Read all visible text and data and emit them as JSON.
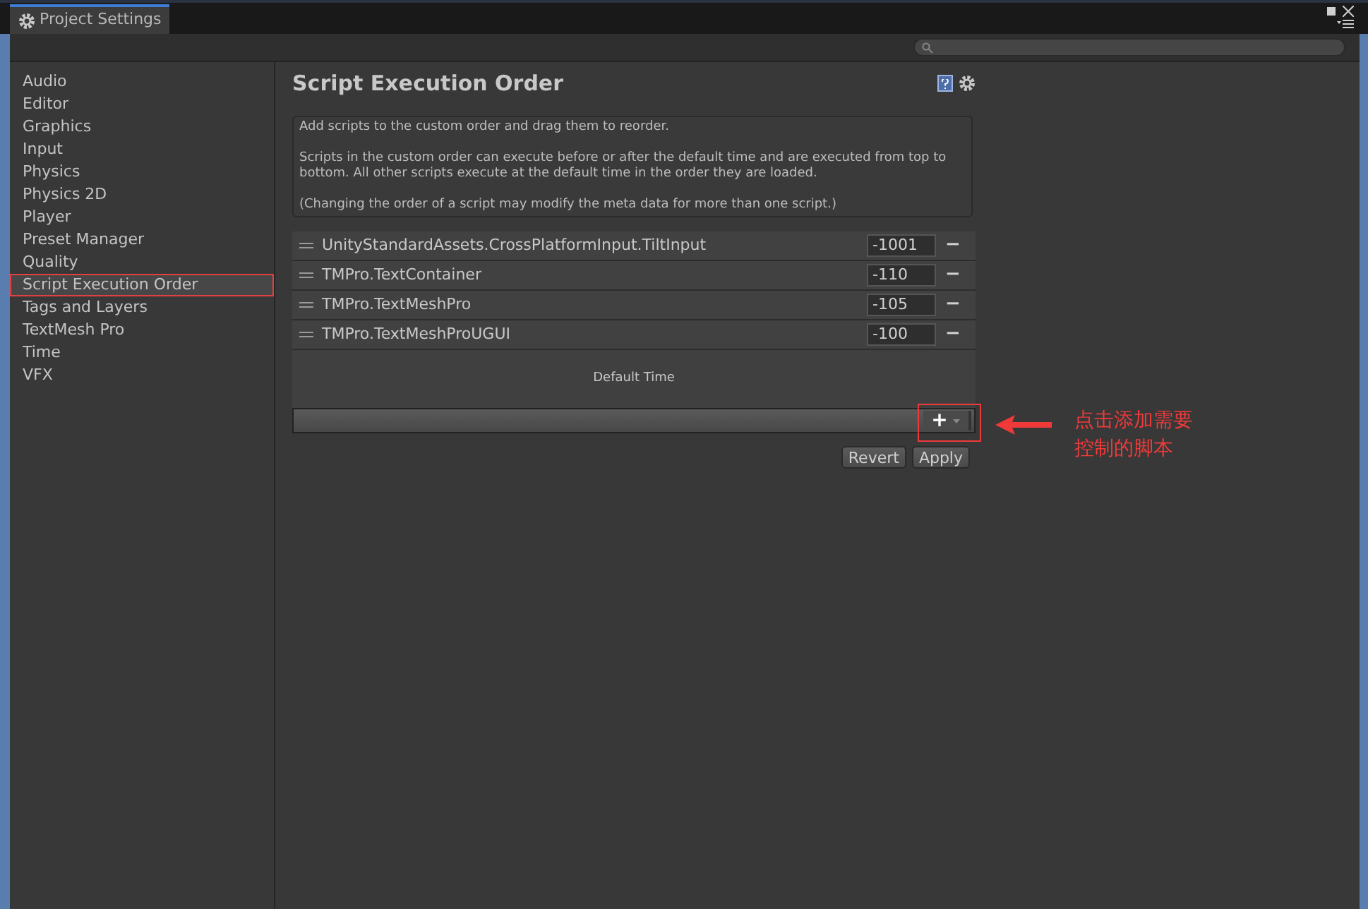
{
  "window": {
    "tab_title": "Project Settings"
  },
  "sidebar": {
    "items": [
      {
        "label": "Audio",
        "selected": false
      },
      {
        "label": "Editor",
        "selected": false
      },
      {
        "label": "Graphics",
        "selected": false
      },
      {
        "label": "Input",
        "selected": false
      },
      {
        "label": "Physics",
        "selected": false
      },
      {
        "label": "Physics 2D",
        "selected": false
      },
      {
        "label": "Player",
        "selected": false
      },
      {
        "label": "Preset Manager",
        "selected": false
      },
      {
        "label": "Quality",
        "selected": false
      },
      {
        "label": "Script Execution Order",
        "selected": true
      },
      {
        "label": "Tags and Layers",
        "selected": false
      },
      {
        "label": "TextMesh Pro",
        "selected": false
      },
      {
        "label": "Time",
        "selected": false
      },
      {
        "label": "VFX",
        "selected": false
      }
    ]
  },
  "panel": {
    "title": "Script Execution Order",
    "help": [
      "Add scripts to the custom order and drag them to reorder.",
      "Scripts in the custom order can execute before or after the default time and are executed from top to bottom. All other scripts execute at the default time in the order they are loaded.",
      "(Changing the order of a script may modify the meta data for more than one script.)"
    ],
    "scripts": [
      {
        "name": "UnityStandardAssets.CrossPlatformInput.TiltInput",
        "order": "-1001",
        "remove": "−"
      },
      {
        "name": "TMPro.TextContainer",
        "order": "-110",
        "remove": "−"
      },
      {
        "name": "TMPro.TextMeshPro",
        "order": "-105",
        "remove": "−"
      },
      {
        "name": "TMPro.TextMeshProUGUI",
        "order": "-100",
        "remove": "−"
      }
    ],
    "default_time": "Default Time",
    "add_button": "+",
    "buttons": [
      "Revert",
      "Apply"
    ]
  },
  "annotation": {
    "text": [
      "点击添加需要",
      "控制的脚本"
    ]
  }
}
